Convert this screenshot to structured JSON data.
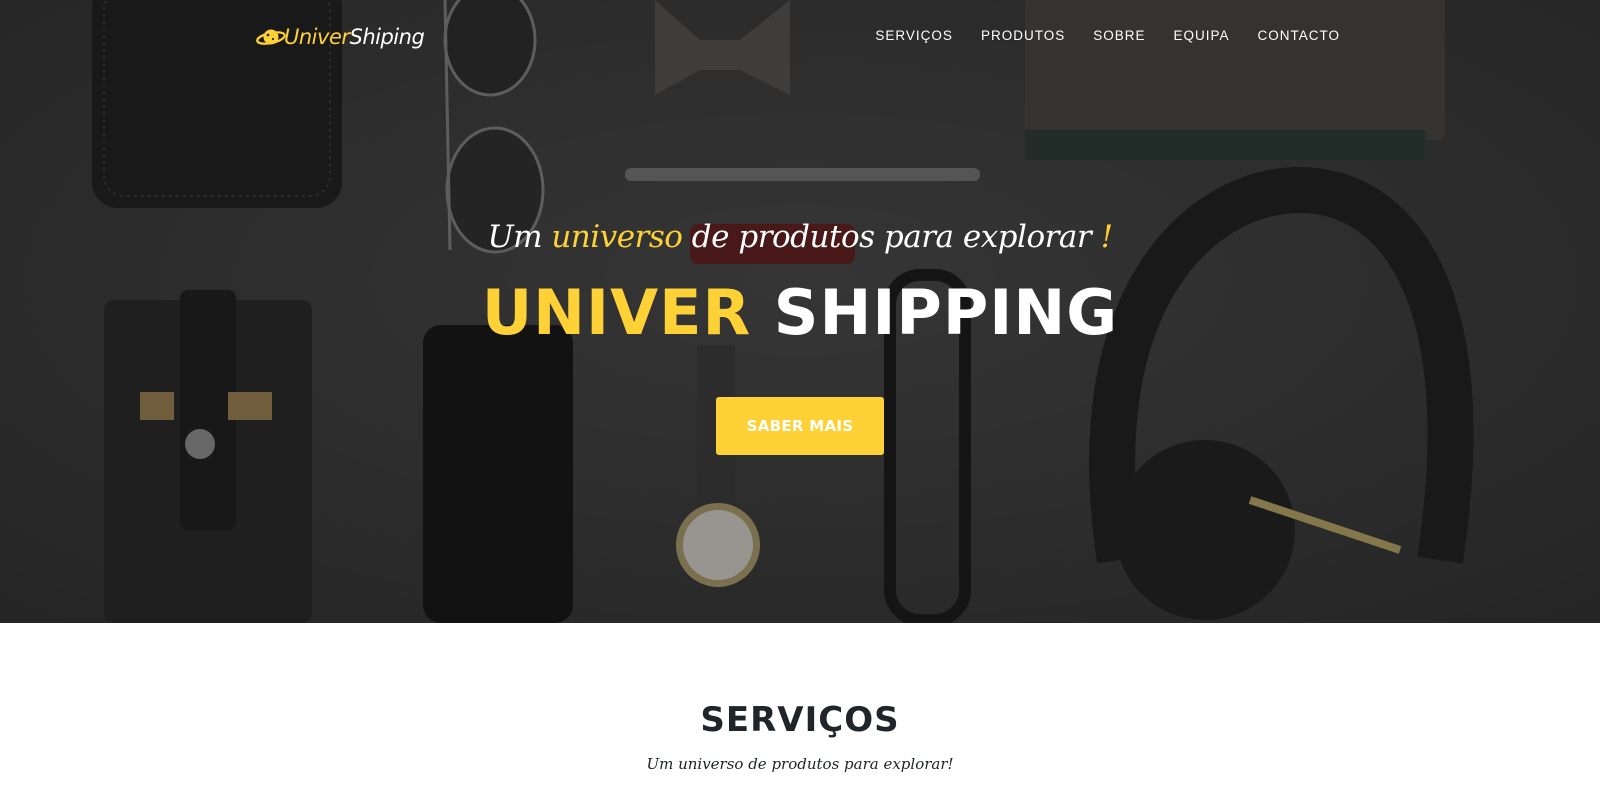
{
  "colors": {
    "accent": "#fed136",
    "hero_overlay": "#2b2b2b",
    "heading_dark": "#212529",
    "white": "#ffffff"
  },
  "logo": {
    "part_accent": "Univer",
    "part_main": "Shiping",
    "icon": "planet-icon"
  },
  "nav": {
    "items": [
      {
        "label": "SERVIÇOS"
      },
      {
        "label": "PRODUTOS"
      },
      {
        "label": "SOBRE"
      },
      {
        "label": "EQUIPA"
      },
      {
        "label": "CONTACTO"
      }
    ]
  },
  "hero": {
    "lead_before": "Um ",
    "lead_accent": "universo",
    "lead_after": " de produtos para explorar ",
    "lead_exclaim": "!",
    "heading_accent": "UNIVER",
    "heading_main": " SHIPPING",
    "cta_label": "SABER MAIS"
  },
  "services": {
    "title": "SERVIÇOS",
    "subtitle": "Um universo de produtos para explorar!"
  }
}
